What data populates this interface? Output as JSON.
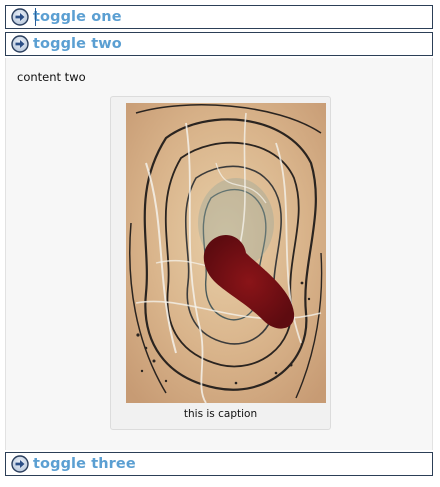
{
  "toggles": [
    {
      "label": "toggle one",
      "icon": "arrow-right-circle-icon",
      "expanded": false
    },
    {
      "label": "toggle two",
      "icon": "arrow-right-circle-icon",
      "expanded": true
    },
    {
      "label": "toggle three",
      "icon": "arrow-right-circle-icon",
      "expanded": false
    }
  ],
  "panel": {
    "text": "content two",
    "figure": {
      "caption": "this is caption"
    }
  },
  "colors": {
    "toggle_text": "#5b9fd2",
    "toggle_border": "#2c3f57",
    "panel_bg": "#f7f7f7"
  }
}
